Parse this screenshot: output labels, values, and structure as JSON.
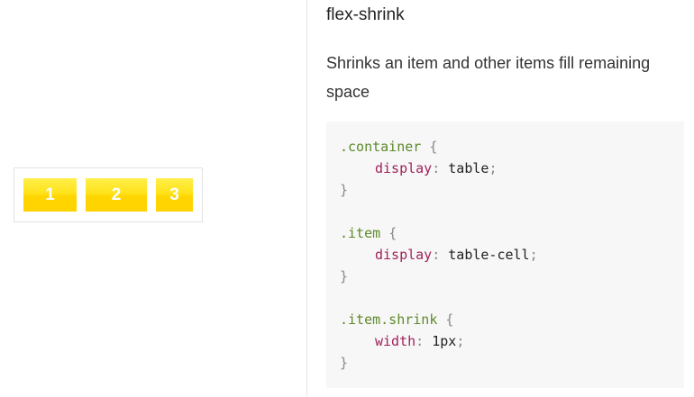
{
  "demo": {
    "items": [
      {
        "label": "1"
      },
      {
        "label": "2"
      },
      {
        "label": "3"
      }
    ]
  },
  "section": {
    "title": "flex-shrink",
    "description": "Shrinks an item and other items fill remaining space"
  },
  "code": {
    "container_selector": ".container",
    "container_prop": "display",
    "container_value": "table",
    "item_selector": ".item",
    "item_prop": "display",
    "item_value": "table-cell",
    "shrink_selector": ".item.shrink",
    "shrink_prop": "width",
    "shrink_value": "1px",
    "open_brace": "{",
    "close_brace": "}",
    "colon": ":",
    "semicolon": ";"
  },
  "colors": {
    "item_yellow": "#ffd800",
    "selector_green": "#5d8a2a",
    "property_magenta": "#a0225a"
  }
}
